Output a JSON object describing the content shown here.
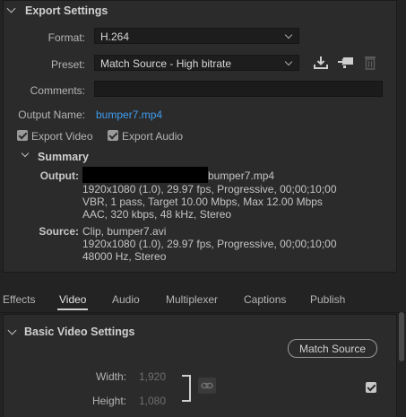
{
  "export_settings": {
    "title": "Export Settings",
    "format_label": "Format:",
    "format_value": "H.264",
    "preset_label": "Preset:",
    "preset_value": "Match Source - High bitrate",
    "comments_label": "Comments:",
    "comments_value": "",
    "output_name_label": "Output Name:",
    "output_name_value": "bumper7.mp4",
    "export_video_label": "Export Video",
    "export_video_checked": true,
    "export_audio_label": "Export Audio",
    "export_audio_checked": true
  },
  "summary": {
    "title": "Summary",
    "output_key": "Output:",
    "output_lines": [
      "bumper7.mp4",
      "1920x1080 (1.0), 29.97 fps, Progressive, 00;00;10;00",
      "VBR, 1 pass, Target 10.00 Mbps, Max 12.00 Mbps",
      "AAC, 320 kbps, 48 kHz, Stereo"
    ],
    "source_key": "Source:",
    "source_lines": [
      "Clip, bumper7.avi",
      "1920x1080 (1.0), 29.97 fps, Progressive, 00;00;10;00",
      "48000 Hz, Stereo"
    ]
  },
  "tabs": [
    "Effects",
    "Video",
    "Audio",
    "Multiplexer",
    "Captions",
    "Publish"
  ],
  "active_tab": "Video",
  "basic_video": {
    "title": "Basic Video Settings",
    "match_source_label": "Match Source",
    "width_label": "Width:",
    "width_value": "1,920",
    "height_label": "Height:",
    "height_value": "1,080",
    "checkbox_checked": true
  },
  "icons": [
    "save-preset-icon",
    "import-preset-icon",
    "delete-preset-icon",
    "link-icon"
  ]
}
